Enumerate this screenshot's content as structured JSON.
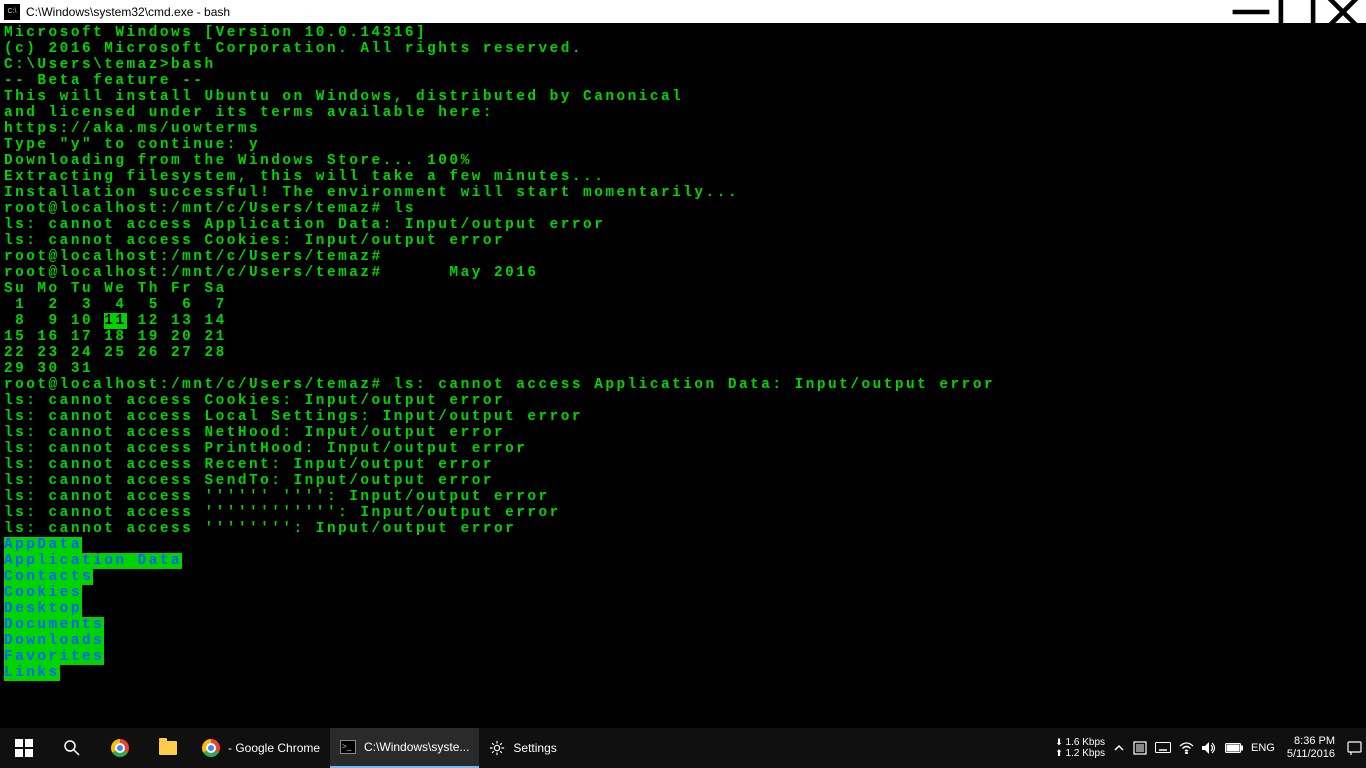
{
  "window": {
    "title": "C:\\Windows\\system32\\cmd.exe - bash",
    "icon_label": "C:\\"
  },
  "terminal": {
    "lines_pre_cal": [
      "Microsoft Windows [Version 10.0.14316]",
      "(c) 2016 Microsoft Corporation. All rights reserved.",
      "",
      "C:\\Users\\temaz>bash",
      "-- Beta feature --",
      "This will install Ubuntu on Windows, distributed by Canonical",
      "and licensed under its terms available here:",
      "https://aka.ms/uowterms",
      "",
      "Type \"y\" to continue: y",
      "Downloading from the Windows Store... 100%",
      "Extracting filesystem, this will take a few minutes...",
      "Installation successful! The environment will start momentarily...",
      "root@localhost:/mnt/c/Users/temaz# ls",
      "ls: cannot access Application Data: Input/output error",
      "ls: cannot access Cookies: Input/output error",
      "root@localhost:/mnt/c/Users/temaz#",
      "root@localhost:/mnt/c/Users/temaz#      May 2016"
    ],
    "calendar": {
      "header": "Su Mo Tu We Th Fr Sa",
      "rows": [
        " 1  2  3  4  5  6  7",
        " 8  9 10 [11] 12 13 14",
        "15 16 17 18 19 20 21",
        "22 23 24 25 26 27 28",
        "29 30 31"
      ],
      "highlighted_day": "11"
    },
    "lines_post_cal": [
      "",
      "root@localhost:/mnt/c/Users/temaz# ls: cannot access Application Data: Input/output error",
      "ls: cannot access Cookies: Input/output error",
      "ls: cannot access Local Settings: Input/output error",
      "ls: cannot access NetHood: Input/output error",
      "ls: cannot access PrintHood: Input/output error",
      "ls: cannot access Recent: Input/output error",
      "ls: cannot access SendTo: Input/output error",
      "ls: cannot access '''''' '''': Input/output error",
      "ls: cannot access '''''''''''': Input/output error",
      "ls: cannot access '''''''': Input/output error"
    ],
    "dirs": [
      "AppData",
      "Application Data",
      "Contacts",
      "Cookies",
      "Desktop",
      "Documents",
      "Downloads",
      "Favorites",
      "Links"
    ]
  },
  "taskbar": {
    "apps": [
      {
        "label": "- Google Chrome"
      },
      {
        "label": "C:\\Windows\\syste..."
      },
      {
        "label": "Settings"
      }
    ],
    "net": {
      "down": "1.6 Kbps",
      "up": "1.2 Kbps"
    },
    "lang": "ENG",
    "clock": {
      "time": "8:36 PM",
      "date": "5/11/2016"
    }
  }
}
